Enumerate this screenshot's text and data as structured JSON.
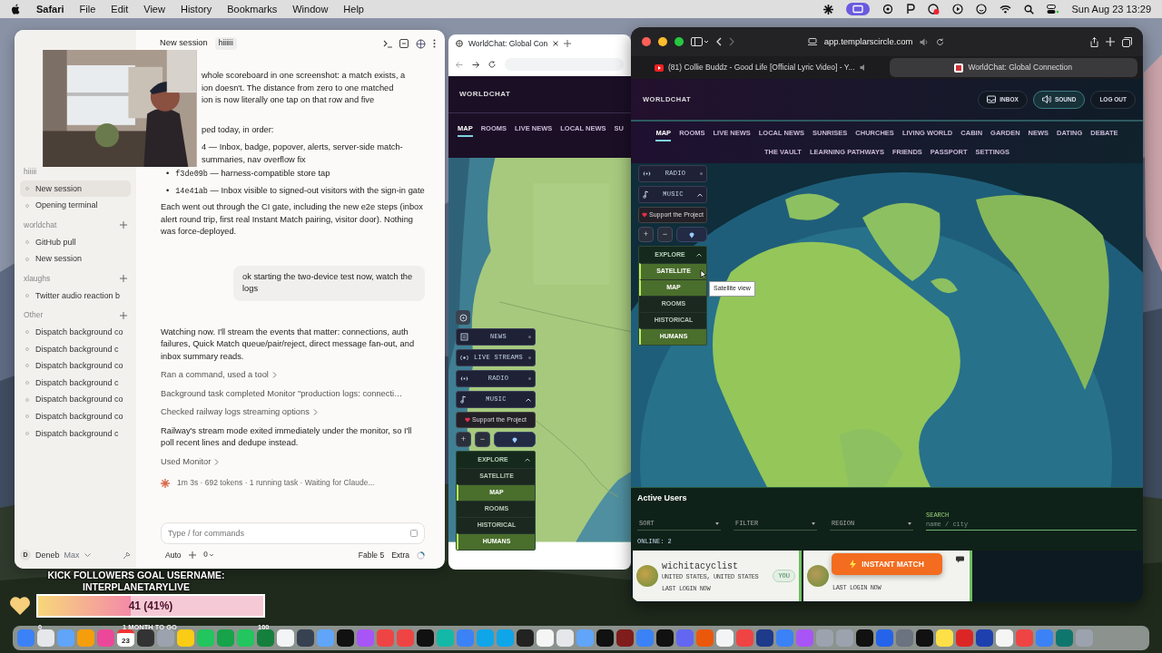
{
  "menu_bar": {
    "app": "Safari",
    "menus": [
      "File",
      "Edit",
      "View",
      "History",
      "Bookmarks",
      "Window",
      "Help"
    ],
    "clock": "Sun Aug 23  13:29"
  },
  "code_app": {
    "header": {
      "title": "New session",
      "tag": "hiiiiii"
    },
    "sidebar": {
      "groups": [
        {
          "label": "hiiiii",
          "addable": false,
          "items": [
            {
              "label": "New session",
              "selected": true
            },
            {
              "label": "Opening terminal",
              "selected": false
            }
          ]
        },
        {
          "label": "worldchat",
          "addable": true,
          "items": [
            {
              "label": "GitHub pull",
              "selected": false
            },
            {
              "label": "New session",
              "selected": false
            }
          ]
        },
        {
          "label": "xlaughs",
          "addable": true,
          "items": [
            {
              "label": "Twitter audio reaction b",
              "selected": false
            }
          ]
        },
        {
          "label": "Other",
          "addable": true,
          "items": [
            {
              "label": "Dispatch background co",
              "selected": false
            },
            {
              "label": "Dispatch background c",
              "selected": false
            },
            {
              "label": "Dispatch background co",
              "selected": false
            },
            {
              "label": "Dispatch background c",
              "selected": false
            },
            {
              "label": "Dispatch background co",
              "selected": false
            },
            {
              "label": "Dispatch background co",
              "selected": false
            },
            {
              "label": "Dispatch background c",
              "selected": false
            }
          ]
        }
      ],
      "user": {
        "initial": "D",
        "name": "Deneb",
        "plan": "Max"
      }
    },
    "chat": {
      "covered_lines": [
        "whole scoreboard in one screenshot: a match exists, a",
        "ion doesn't. The distance from zero to one matched",
        "ion is now literally one tap on that row and five",
        "ped today, in order:",
        "4 — Inbox, badge, popover, alerts, server-side match-",
        "summaries, nav overflow fix"
      ],
      "commits": [
        {
          "marker": "•",
          "hash": "f3de09b",
          "text": "— harness-compatible store tap"
        },
        {
          "marker": "•",
          "hash": "14e41ab",
          "text": "— Inbox visible to signed-out visitors with the sign-in gate"
        }
      ],
      "paragraph": "Each went out through the CI gate, including the new e2e steps (inbox alert round trip, first real Instant Match pairing, visitor door). Nothing was force-deployed.",
      "user_message": "ok starting the two-device test now, watch the logs",
      "reply": "Watching now. I'll stream the events that matter: connections, auth failures, Quick Match queue/pair/reject, direct message fan-out, and inbox summary reads.",
      "steps": [
        {
          "kind": "link",
          "text": "Ran a command, used a tool"
        },
        {
          "kind": "note",
          "text": "Background task completed Monitor \"production logs: connecti…"
        },
        {
          "kind": "link",
          "text": "Checked railway logs streaming options"
        },
        {
          "kind": "text",
          "text": "Railway's stream mode exited immediately under the monitor, so I'll poll recent lines and dedupe instead."
        },
        {
          "kind": "link",
          "text": "Used Monitor"
        }
      ],
      "status": "1m 3s · 692 tokens · 1 running task · Waiting for Claude..."
    },
    "composer": {
      "placeholder": "Type / for commands",
      "mode": "Auto",
      "model": "Fable 5",
      "effort": "Extra"
    }
  },
  "left_browser": {
    "tab": "WorldChat: Global Con",
    "site": {
      "brand": "WORLDCHAT",
      "nav": [
        {
          "label": "MAP",
          "selected": true
        },
        {
          "label": "ROOMS",
          "selected": false
        },
        {
          "label": "LIVE NEWS",
          "selected": false
        },
        {
          "label": "LOCAL NEWS",
          "selected": false
        },
        {
          "label": "SU",
          "selected": false
        }
      ]
    },
    "panel": {
      "layers": [
        {
          "kind": "news",
          "label": "NEWS"
        },
        {
          "kind": "stream",
          "label": "LIVE STREAMS"
        },
        {
          "kind": "radio",
          "label": "RADIO"
        }
      ],
      "music": {
        "label": "MUSIC",
        "expanded": true
      },
      "support": "Support the Project",
      "zoom": [
        "+",
        "−"
      ],
      "explore": {
        "label": "EXPLORE",
        "expanded": true,
        "options": [
          {
            "label": "SATELLITE",
            "selected": false
          },
          {
            "label": "MAP",
            "selected": true
          },
          {
            "label": "ROOMS",
            "selected": false
          },
          {
            "label": "HISTORICAL",
            "selected": false
          },
          {
            "label": "HUMANS",
            "selected": true
          }
        ]
      }
    }
  },
  "right_browser": {
    "url": "app.templarscircle.com",
    "tabs": [
      {
        "title": "(81) Collie Buddz - Good Life [Official Lyric Video] - Y...",
        "selected": false
      },
      {
        "title": "WorldChat: Global Connection",
        "selected": true
      }
    ],
    "site": {
      "brand": "WORLDCHAT",
      "actions": [
        {
          "kind": "inbox",
          "label": "INBOX",
          "selected": false
        },
        {
          "kind": "sound",
          "label": "SOUND",
          "selected": true
        },
        {
          "kind": "plain",
          "label": "LOG OUT",
          "selected": false
        }
      ],
      "nav_rows": [
        [
          {
            "label": "MAP",
            "selected": true
          },
          {
            "label": "ROOMS",
            "selected": false
          },
          {
            "label": "LIVE NEWS",
            "selected": false
          },
          {
            "label": "LOCAL NEWS",
            "selected": false
          },
          {
            "label": "SUNRISES",
            "selected": false
          },
          {
            "label": "CHURCHES",
            "selected": false
          },
          {
            "label": "LIVING WORLD",
            "selected": false
          },
          {
            "label": "CABIN",
            "selected": false
          },
          {
            "label": "GARDEN",
            "selected": false
          },
          {
            "label": "NEWS",
            "selected": false
          },
          {
            "label": "DATING",
            "selected": false
          },
          {
            "label": "DEBATE",
            "selected": false
          }
        ],
        [
          {
            "label": "THE VAULT",
            "selected": false
          },
          {
            "label": "LEARNING PATHWAYS",
            "selected": false
          },
          {
            "label": "FRIENDS",
            "selected": false
          },
          {
            "label": "PASSPORT",
            "selected": false
          },
          {
            "label": "SETTINGS",
            "selected": false
          }
        ]
      ]
    },
    "panel": {
      "layers": [
        {
          "kind": "radio",
          "label": "RADIO"
        }
      ],
      "music": {
        "label": "MUSIC",
        "expanded": true
      },
      "support": "Support the Project",
      "zoom": [
        "+",
        "−"
      ],
      "explore": {
        "label": "EXPLORE",
        "expanded": true,
        "options": [
          {
            "label": "SATELLITE",
            "selected": true
          },
          {
            "label": "MAP",
            "selected": true
          },
          {
            "label": "ROOMS",
            "selected": false
          },
          {
            "label": "HISTORICAL",
            "selected": false
          },
          {
            "label": "HUMANS",
            "selected": true
          }
        ]
      }
    },
    "tooltip": "Satellite view",
    "active_users": {
      "title": "Active Users",
      "filters": [
        "SORT",
        "FILTER",
        "REGION"
      ],
      "search_label": "SEARCH",
      "search_placeholder": "name / city",
      "online": "ONLINE: 2",
      "users": [
        {
          "name": "wichitacyclist",
          "location": "UNITED STATES, UNITED STATES",
          "last_login": "LAST LOGIN NOW",
          "badge": "YOU"
        },
        {
          "last_login": "LAST LOGIN NOW"
        }
      ],
      "instant_match": "INSTANT MATCH"
    }
  },
  "stream_overlay": {
    "goal_title": "KICK FOLLOWERS GOAL USERNAME:",
    "goal_user": "INTERPLANETARYLIVE",
    "progress": "41 (41%)",
    "level": 0.41,
    "min": "0",
    "caption": "1 MONTH TO GO",
    "max": "100"
  },
  "dock": {
    "calendar_day": "23"
  }
}
